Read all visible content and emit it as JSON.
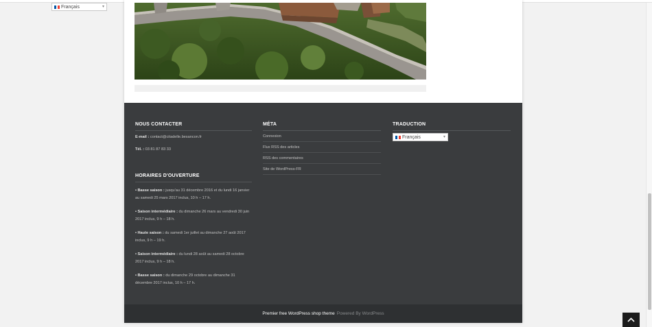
{
  "language_selector": {
    "selected": "Français",
    "flag_colors": [
      "#0055a4",
      "#ffffff",
      "#ef4135"
    ]
  },
  "footer": {
    "contact": {
      "title": "NOUS CONTACTER",
      "email_label": "E-mail :",
      "email_value": "contact@citadelle.besancon.fr",
      "phone_label": "Tél. :",
      "phone_value": "03 81 87 83 33"
    },
    "hours": {
      "title": "HORAIRES D'OUVERTURE",
      "entries": [
        {
          "label": "• Basse saison :",
          "text": "jusqu'au 31 décembre 2016 et du lundi 16 janvier au samedi 25 mars 2017 inclus, 10 h – 17 h."
        },
        {
          "label": "• Saison intermédiaire :",
          "text": "du dimanche 26 mars au vendredi 30 juin 2017 inclus, 9 h – 18 h."
        },
        {
          "label": "• Haute saison :",
          "text": "du samedi 1er juillet au dimanche 27 août 2017 inclus, 9 h – 19 h."
        },
        {
          "label": "• Saison intermédiaire :",
          "text": "du lundi 28 août au samedi 28 octobre 2017 inclus, 9 h – 18 h."
        },
        {
          "label": "• Basse saison :",
          "text": "du dimanche 29 octobre au dimanche 31 décembre 2017 inclus, 10 h – 17 h."
        }
      ]
    },
    "meta": {
      "title": "MÉTA",
      "links": [
        "Connexion",
        "Flux RSS des articles",
        "RSS des commentaires",
        "Site de WordPress-FR"
      ]
    },
    "translation": {
      "title": "TRADUCTION"
    },
    "credits": {
      "theme": "Premier free WordPress shop theme",
      "powered": "Powered By WordPress"
    }
  },
  "icons": {
    "back_to_top": "chevron-up-icon",
    "caret": "caret-down-icon",
    "flag": "france-flag-icon"
  }
}
